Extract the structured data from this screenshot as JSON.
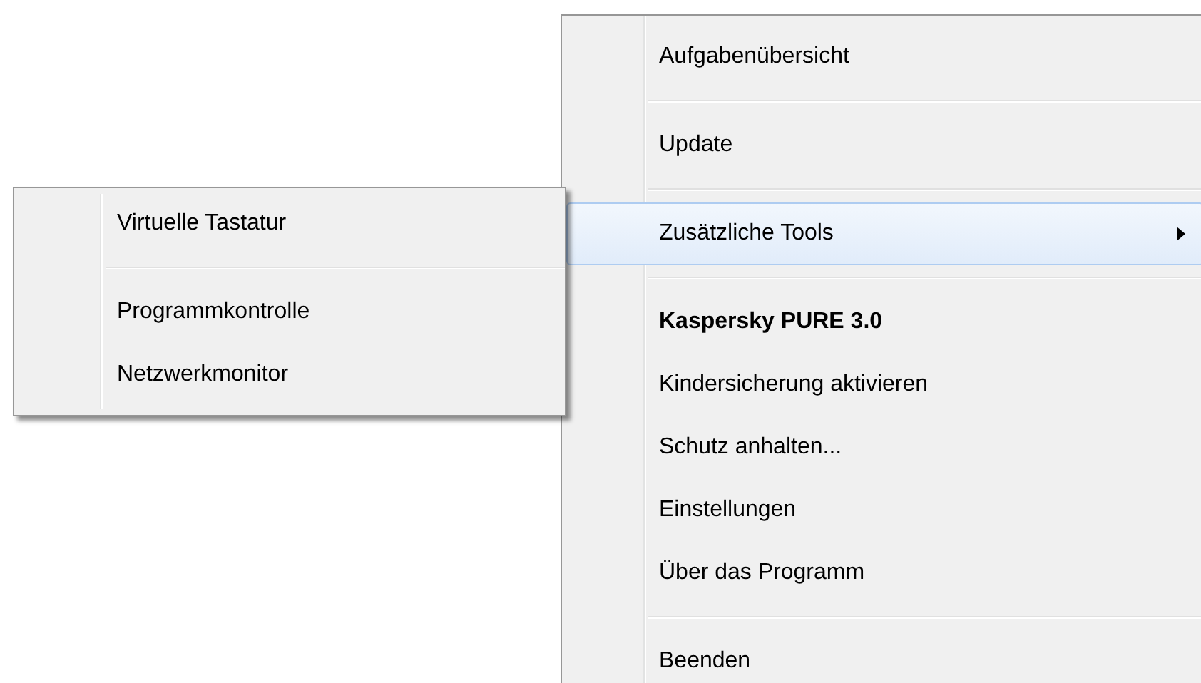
{
  "main_menu": {
    "items": [
      {
        "kind": "item",
        "label": "Aufgabenübersicht",
        "selected": false,
        "default": false,
        "has_submenu": false
      },
      {
        "kind": "separator"
      },
      {
        "kind": "item",
        "label": "Update",
        "selected": false,
        "default": false,
        "has_submenu": false
      },
      {
        "kind": "separator"
      },
      {
        "kind": "item",
        "label": "Zusätzliche Tools",
        "selected": true,
        "default": false,
        "has_submenu": true
      },
      {
        "kind": "separator"
      },
      {
        "kind": "item",
        "label": "Kaspersky PURE 3.0",
        "selected": false,
        "default": true,
        "has_submenu": false
      },
      {
        "kind": "item",
        "label": "Kindersicherung aktivieren",
        "selected": false,
        "default": false,
        "has_submenu": false
      },
      {
        "kind": "item",
        "label": "Schutz anhalten...",
        "selected": false,
        "default": false,
        "has_submenu": false
      },
      {
        "kind": "item",
        "label": "Einstellungen",
        "selected": false,
        "default": false,
        "has_submenu": false
      },
      {
        "kind": "item",
        "label": "Über das Programm",
        "selected": false,
        "default": false,
        "has_submenu": false
      },
      {
        "kind": "separator"
      },
      {
        "kind": "item",
        "label": "Beenden",
        "selected": false,
        "default": false,
        "has_submenu": false
      }
    ]
  },
  "submenu": {
    "items": [
      {
        "kind": "item",
        "label": "Virtuelle Tastatur",
        "selected": false,
        "default": false,
        "has_submenu": false
      },
      {
        "kind": "separator"
      },
      {
        "kind": "item",
        "label": "Programmkontrolle",
        "selected": false,
        "default": false,
        "has_submenu": false
      },
      {
        "kind": "item",
        "label": "Netzwerkmonitor",
        "selected": false,
        "default": false,
        "has_submenu": false
      }
    ]
  }
}
